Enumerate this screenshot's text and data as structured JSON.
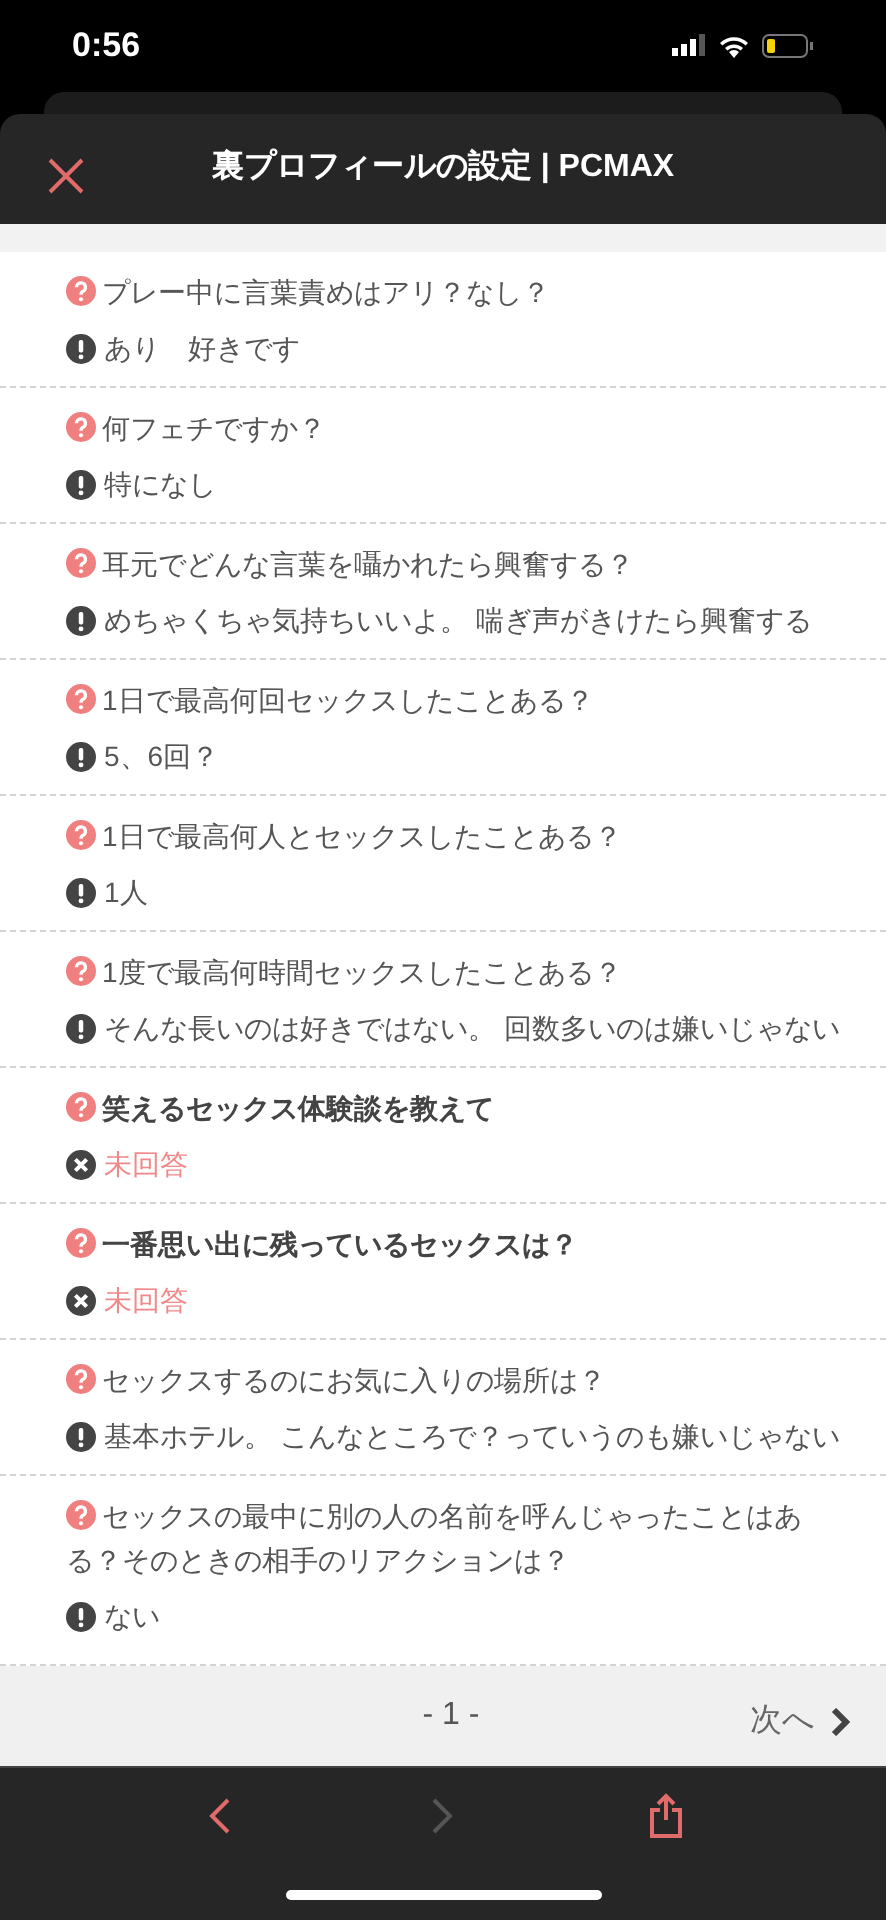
{
  "status_bar": {
    "time": "0:56"
  },
  "header": {
    "title": "裏プロフィールの設定 | PCMAX"
  },
  "questions": [
    {
      "question": "プレー中に言葉責めはアリ？なし？",
      "answer": "あり　好きです",
      "answered": true
    },
    {
      "question": "何フェチですか？",
      "answer": "特になし",
      "answered": true
    },
    {
      "question": "耳元でどんな言葉を囁かれたら興奮する？",
      "answer": "めちゃくちゃ気持ちいいよ。 喘ぎ声がきけたら興奮する",
      "answered": true
    },
    {
      "question": "1日で最高何回セックスしたことある？",
      "answer": "5、6回？",
      "answered": true
    },
    {
      "question": "1日で最高何人とセックスしたことある？",
      "answer": "1人",
      "answered": true
    },
    {
      "question": "1度で最高何時間セックスしたことある？",
      "answer": "そんな長いのは好きではない。 回数多いのは嫌いじゃない",
      "answered": true
    },
    {
      "question": "笑えるセックス体験談を教えて",
      "answer": "未回答",
      "answered": false
    },
    {
      "question": "一番思い出に残っているセックスは？",
      "answer": "未回答",
      "answered": false
    },
    {
      "question": "セックスするのにお気に入りの場所は？",
      "answer": "基本ホテル。 こんなところで？っていうのも嫌いじゃない",
      "answered": true
    },
    {
      "question": "セックスの最中に別の人の名前を呼んじゃったことはある？そのときの相手のリアクションは？",
      "answer": "ない",
      "answered": true
    }
  ],
  "pagination": {
    "page": "- 1 -",
    "next": "次へ"
  },
  "toolbar": {
    "back_disabled": false,
    "forward_disabled": true
  }
}
